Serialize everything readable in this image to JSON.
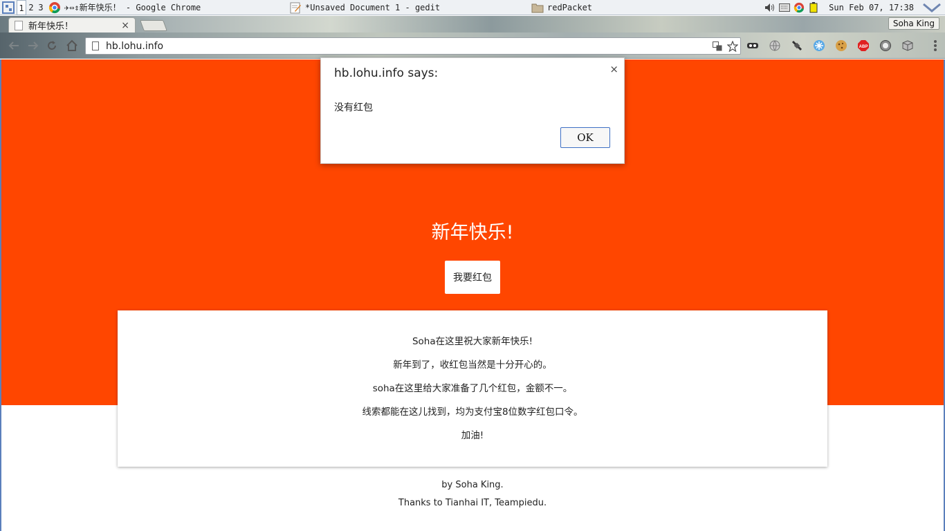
{
  "panel": {
    "workspaces": [
      "1",
      "2",
      "3"
    ],
    "tasks": {
      "chrome": "✈⇔⇕新年快乐！ - Google Chrome",
      "gedit": "*Unsaved Document 1 - gedit",
      "folder": "redPacket"
    },
    "clock": "Sun Feb 07, 17:38"
  },
  "browser": {
    "tab_title": "新年快乐！",
    "tab_close": "×",
    "profile_name": "Soha King",
    "url": "hb.lohu.info"
  },
  "page": {
    "hero_title": "新年快乐!",
    "hongbao_button": "我要红包",
    "card_lines": [
      "Soha在这里祝大家新年快乐!",
      "新年到了，收红包当然是十分开心的。",
      "soha在这里给大家准备了几个红包，金额不一。",
      "线索都能在这儿找到，均为支付宝8位数字红包口令。",
      "加油!"
    ],
    "footer_lines": [
      "by Soha King.",
      "Thanks to Tianhai IT, Teampiedu."
    ],
    "colors": {
      "hero": "#ff4600",
      "link_border": "#3d6fc4"
    }
  },
  "dialog": {
    "title": "hb.lohu.info says:",
    "close": "×",
    "message": "没有红包",
    "ok": "OK"
  },
  "icons": [
    "desktop-logo-icon",
    "chrome-icon",
    "gedit-icon",
    "folder-icon",
    "volume-icon",
    "keyboard-icon",
    "battery-icon",
    "back-icon",
    "forward-icon",
    "reload-icon",
    "home-icon",
    "page-icon",
    "translate-icon",
    "star-icon",
    "adblock-icon",
    "menu-icon"
  ]
}
